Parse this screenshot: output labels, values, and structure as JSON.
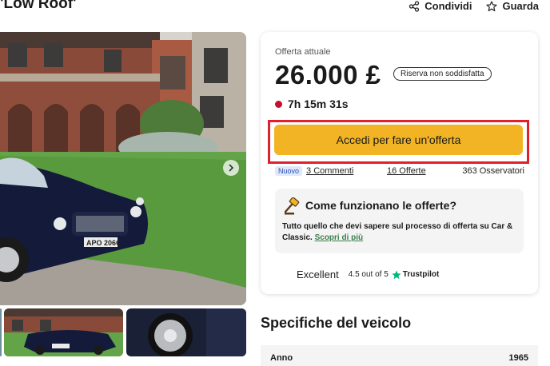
{
  "header": {
    "title": "'Low Roof'",
    "share_label": "Condividi",
    "watch_label": "Guarda"
  },
  "auction": {
    "current_offer_label": "Offerta attuale",
    "amount": "26.000 £",
    "reserve_badge": "Riserva non soddisfatta",
    "time_left": "7h 15m 31s",
    "cta_label": "Accedi per fare un'offerta",
    "new_badge": "Nuovo",
    "comments": "3 Commenti",
    "offers": "16 Offerte",
    "watchers": "363 Osservatori"
  },
  "info": {
    "title": "Come funzionano le offerte?",
    "text": "Tutto quello che devi sapere sul processo di offerta su Car & Classic.",
    "link": "Scopri di più"
  },
  "trustpilot": {
    "word": "Excellent",
    "rating": "4.5 out of 5",
    "brand": "Trustpilot"
  },
  "specs": {
    "title": "Specifiche del veicolo",
    "rows": [
      {
        "label": "Anno",
        "value": "1965"
      }
    ]
  },
  "colors": {
    "cta": "#f2b424",
    "highlight_frame": "#e0202a",
    "timer_dot": "#c8102e",
    "link_green": "#3c7d4a"
  },
  "icons": {
    "share": "share-icon",
    "watch": "star-icon",
    "next": "chevron-right-icon",
    "info": "gavel-icon",
    "trustpilot": "trustpilot-star-icon"
  }
}
